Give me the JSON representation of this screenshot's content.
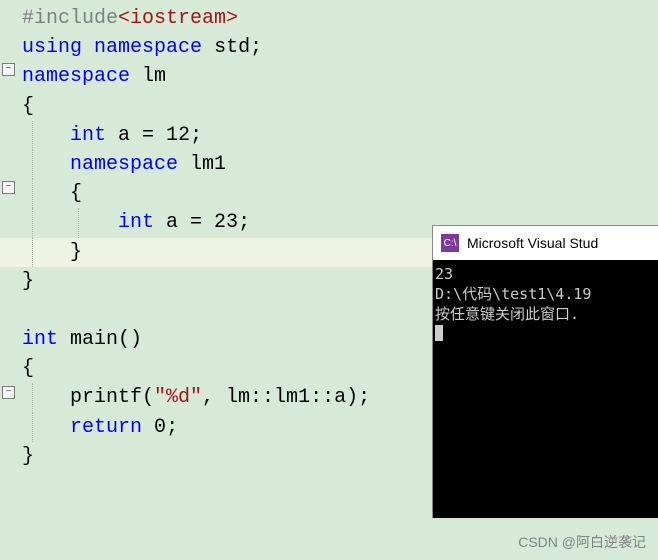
{
  "code": {
    "l1a": "#include",
    "l1b": "<iostream>",
    "l2a": "using",
    "l2b": " ",
    "l2c": "namespace",
    "l2d": " std;",
    "l3a": "namespace",
    "l3b": " lm",
    "l4": "{",
    "l5a": "    ",
    "l5b": "int",
    "l5c": " a = ",
    "l5d": "12",
    "l5e": ";",
    "l6a": "    ",
    "l6b": "namespace",
    "l6c": " lm1",
    "l7": "    {",
    "l8a": "        ",
    "l8b": "int",
    "l8c": " a = ",
    "l8d": "23",
    "l8e": ";",
    "l9": "    }",
    "l10": "}",
    "l11": "",
    "l12a": "int",
    "l12b": " main()",
    "l13": "{",
    "l14a": "    printf(",
    "l14b": "\"%d\"",
    "l14c": ", lm::lm1::a);",
    "l15a": "    ",
    "l15b": "return",
    "l15c": " ",
    "l15d": "0",
    "l15e": ";",
    "l16": "}"
  },
  "foldGlyph": "−",
  "console": {
    "iconText": "C:\\",
    "title": "Microsoft Visual Stud",
    "out1": "23",
    "out2": "D:\\代码\\test1\\4.19",
    "out3": "按任意键关闭此窗口."
  },
  "watermark": "CSDN @阿白逆袭记"
}
